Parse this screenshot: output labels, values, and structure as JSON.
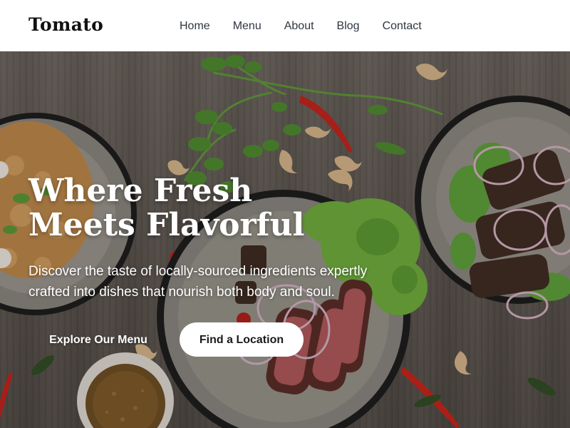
{
  "brand": {
    "logo": "Tomato"
  },
  "nav": {
    "items": [
      {
        "label": "Home"
      },
      {
        "label": "Menu"
      },
      {
        "label": "About"
      },
      {
        "label": "Blog"
      },
      {
        "label": "Contact"
      }
    ]
  },
  "hero": {
    "title": "Where Fresh Meets Flavorful",
    "subtitle": "Discover the taste of locally-sourced ingredients expertly crafted into dishes that nourish both body and soul.",
    "primary_cta": "Explore Our Menu",
    "secondary_cta": "Find a Location"
  },
  "colors": {
    "header_bg": "#ffffff",
    "text_dark": "#111111",
    "hero_text": "#ffffff",
    "button_bg": "#ffffff"
  }
}
